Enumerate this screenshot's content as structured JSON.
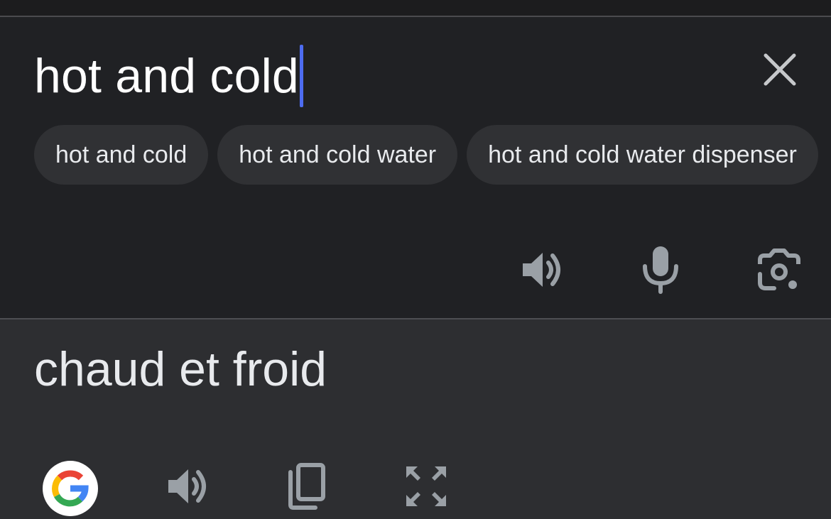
{
  "source": {
    "text": "hot and cold",
    "clear_icon": "close-icon"
  },
  "suggestions": [
    {
      "label": "hot and cold"
    },
    {
      "label": "hot and cold water"
    },
    {
      "label": "hot and cold water dispenser"
    }
  ],
  "source_actions": [
    {
      "icon": "speaker-icon"
    },
    {
      "icon": "microphone-icon"
    },
    {
      "icon": "camera-lens-icon"
    }
  ],
  "translation": {
    "text": "chaud et froid"
  },
  "translation_actions": [
    {
      "icon": "google-logo-icon"
    },
    {
      "icon": "speaker-icon"
    },
    {
      "icon": "copy-icon"
    },
    {
      "icon": "fullscreen-icon"
    }
  ],
  "colors": {
    "background": "#202124",
    "panel": "#2d2e31",
    "chip": "#303134",
    "caret": "#4d6cf0",
    "icon": "#9aa0a6",
    "text": "#ffffff"
  }
}
